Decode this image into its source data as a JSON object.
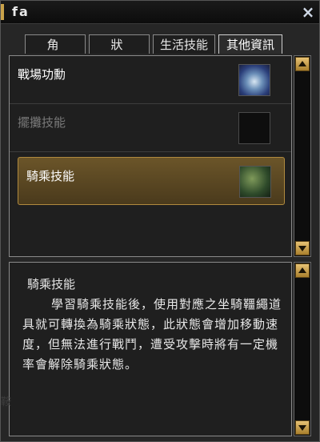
{
  "window": {
    "title": "fa",
    "close_icon": "×"
  },
  "tabs": [
    {
      "label": "角色",
      "active": false
    },
    {
      "label": "狀態",
      "active": false
    },
    {
      "label": "生活技能",
      "active": false
    },
    {
      "label": "其他資訊",
      "active": true
    }
  ],
  "skills": [
    {
      "name": "戰場功勳",
      "icon": "battle-medal-icon",
      "enabled": true,
      "selected": false
    },
    {
      "name": "擺攤技能",
      "icon": "stall-icon",
      "enabled": false,
      "selected": false
    },
    {
      "name": "騎乘技能",
      "icon": "riding-icon",
      "enabled": true,
      "selected": true
    }
  ],
  "description": {
    "title": "騎乘技能",
    "body": "學習騎乘技能後，使用對應之坐騎韁繩道具就可轉換為騎乘狀態，此狀態會增加移動速度，但無法進行戰鬥，遭受攻擊時將有一定機率會解除騎乘狀態。"
  },
  "background_text": "鞍"
}
